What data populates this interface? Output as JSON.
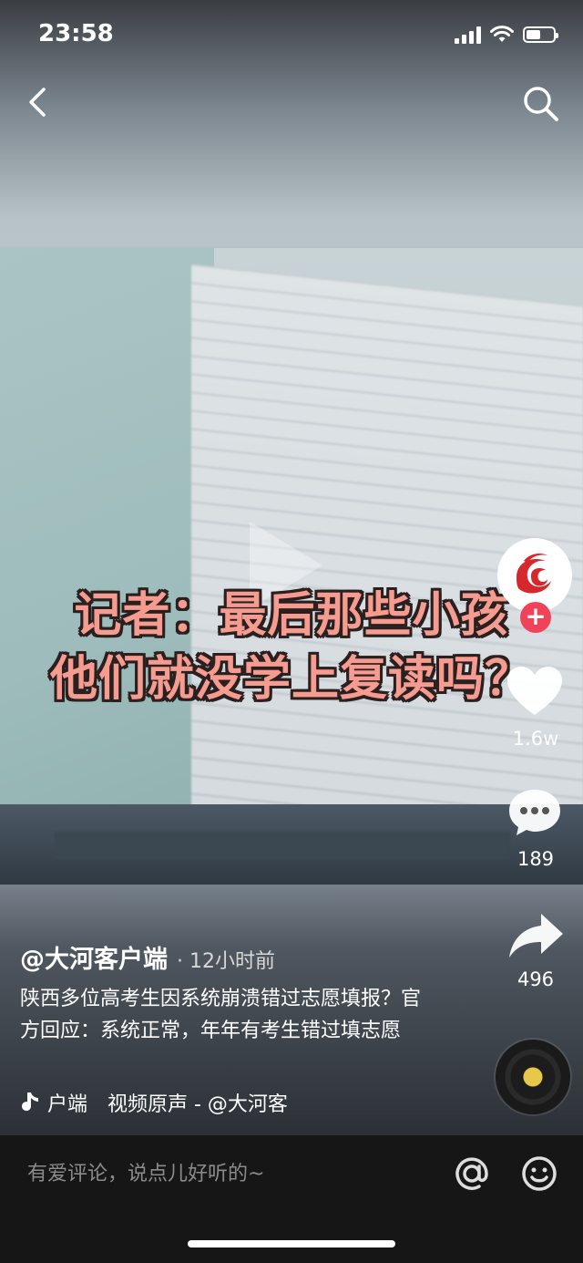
{
  "status_bar": {
    "time": "23:58",
    "battery_level": 0.55
  },
  "video": {
    "caption_line1": "记者：最后那些小孩",
    "caption_line2": "他们就没学上复读吗？"
  },
  "actions": {
    "likes": "1.6w",
    "comments": "189",
    "shares": "496"
  },
  "post": {
    "author": "@大河客户端",
    "time_ago": "· 12小时前",
    "description": "陕西多位高考生因系统崩溃错过志愿填报？官方回应：系统正常，年年有考生错过填志愿",
    "music": "户端　视频原声 - @大河客"
  },
  "comment_bar": {
    "placeholder": "有爱评论，说点儿好听的~"
  },
  "colors": {
    "accent": "#f0435a",
    "caption": "#f59b8f",
    "disc_center": "#e8c84a"
  },
  "icons": [
    "back-icon",
    "search-icon",
    "heart-icon",
    "comment-icon",
    "share-icon",
    "music-note-icon",
    "at-icon",
    "emoji-icon"
  ]
}
